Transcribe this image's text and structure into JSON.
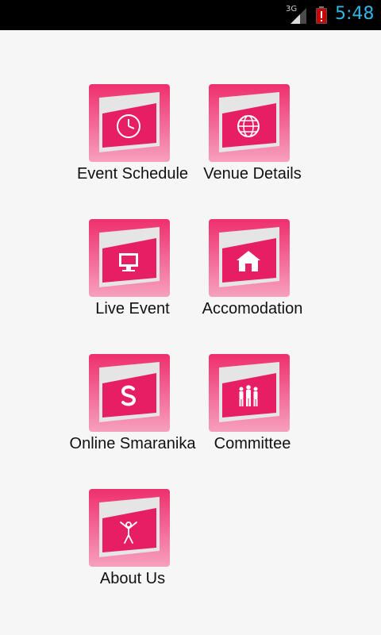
{
  "status_bar": {
    "network": "3G",
    "time": "5:48",
    "battery_color": "#cc0000",
    "time_color": "#33b5e5"
  },
  "theme": {
    "tile_outer": "#f0447a",
    "tile_inner": "#e61e64",
    "tile_panel": "#e5e5e5"
  },
  "menu": [
    {
      "label": "Event Schedule",
      "icon": "clock-icon"
    },
    {
      "label": "Venue Details",
      "icon": "globe-icon"
    },
    {
      "label": "Live Event",
      "icon": "monitor-icon"
    },
    {
      "label": "Accomodation",
      "icon": "house-icon"
    },
    {
      "label": "Online Smaranika",
      "icon": "s-letter-icon"
    },
    {
      "label": "Committee",
      "icon": "people-icon"
    },
    {
      "label": "About Us",
      "icon": "person-icon"
    }
  ]
}
